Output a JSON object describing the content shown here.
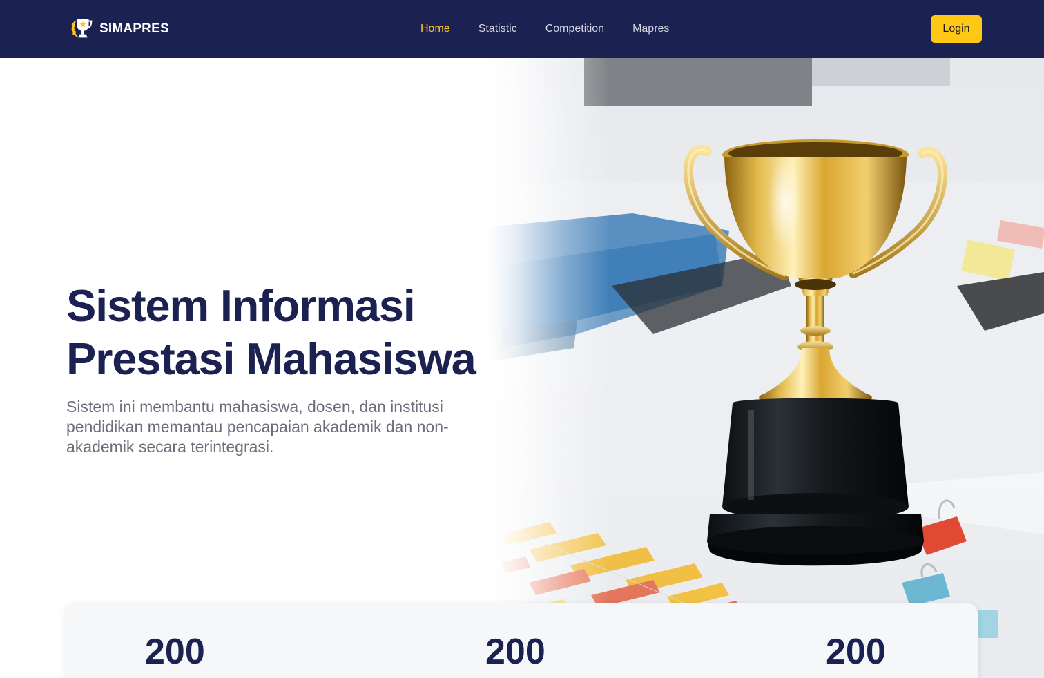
{
  "header": {
    "brand": "SIMAPRES",
    "nav": [
      {
        "label": "Home",
        "active": true
      },
      {
        "label": "Statistic",
        "active": false
      },
      {
        "label": "Competition",
        "active": false
      },
      {
        "label": "Mapres",
        "active": false
      }
    ],
    "login_label": "Login"
  },
  "hero": {
    "title_line1": "Sistem Informasi",
    "title_line2": "Prestasi Mahasiswa",
    "description": "Sistem ini membantu mahasiswa, dosen, dan institusi pendidikan memantau pencapaian akademik dan non-akademik secara terintegrasi.",
    "image_subject": "gold-trophy-on-desk"
  },
  "stats": [
    {
      "value": "200"
    },
    {
      "value": "200"
    },
    {
      "value": "200"
    }
  ],
  "colors": {
    "navbar_bg": "#1b2150",
    "accent": "#ffc815",
    "heading": "#1b2150",
    "body_text": "#6b6f7b"
  },
  "icons": {
    "brand": "trophy-laurel-icon"
  }
}
